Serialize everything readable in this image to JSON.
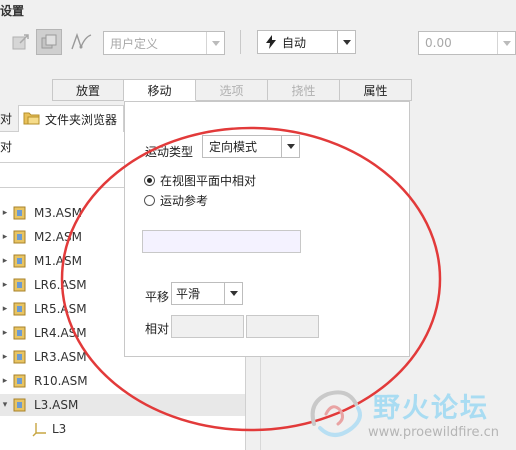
{
  "toolbar": {
    "title": "设置",
    "coord_system": "用户定义",
    "mode": "自动",
    "value": "0.00"
  },
  "tabs": [
    {
      "label": "放置",
      "state": "normal"
    },
    {
      "label": "移动",
      "state": "active"
    },
    {
      "label": "选项",
      "state": "disabled"
    },
    {
      "label": "挠性",
      "state": "disabled"
    },
    {
      "label": "属性",
      "state": "normal"
    }
  ],
  "left_panel": {
    "tab_fragment": "对",
    "browser_tab": "文件夹浏览器",
    "row_fragment": "对"
  },
  "tree": {
    "items": [
      {
        "label": "M3.ASM"
      },
      {
        "label": "M2.ASM"
      },
      {
        "label": "M1.ASM"
      },
      {
        "label": "LR6.ASM"
      },
      {
        "label": "LR5.ASM"
      },
      {
        "label": "LR4.ASM"
      },
      {
        "label": "LR3.ASM"
      },
      {
        "label": "R10.ASM"
      },
      {
        "label": "L3.ASM",
        "selected": true
      },
      {
        "label": "L3",
        "child": true
      }
    ]
  },
  "move_panel": {
    "motion_type_label": "运动类型",
    "motion_type_value": "定向模式",
    "radio_view_plane": "在视图平面中相对",
    "radio_motion_ref": "运动参考",
    "view_plane_selected": true,
    "translate_label": "平移",
    "translate_value": "平滑",
    "relative_label": "相对"
  },
  "watermark": {
    "title": "野火论坛",
    "url": "www.proewildfire.cn"
  },
  "colors": {
    "annotation": "#e23a3a",
    "watermark_text": "#a9dcf2"
  }
}
